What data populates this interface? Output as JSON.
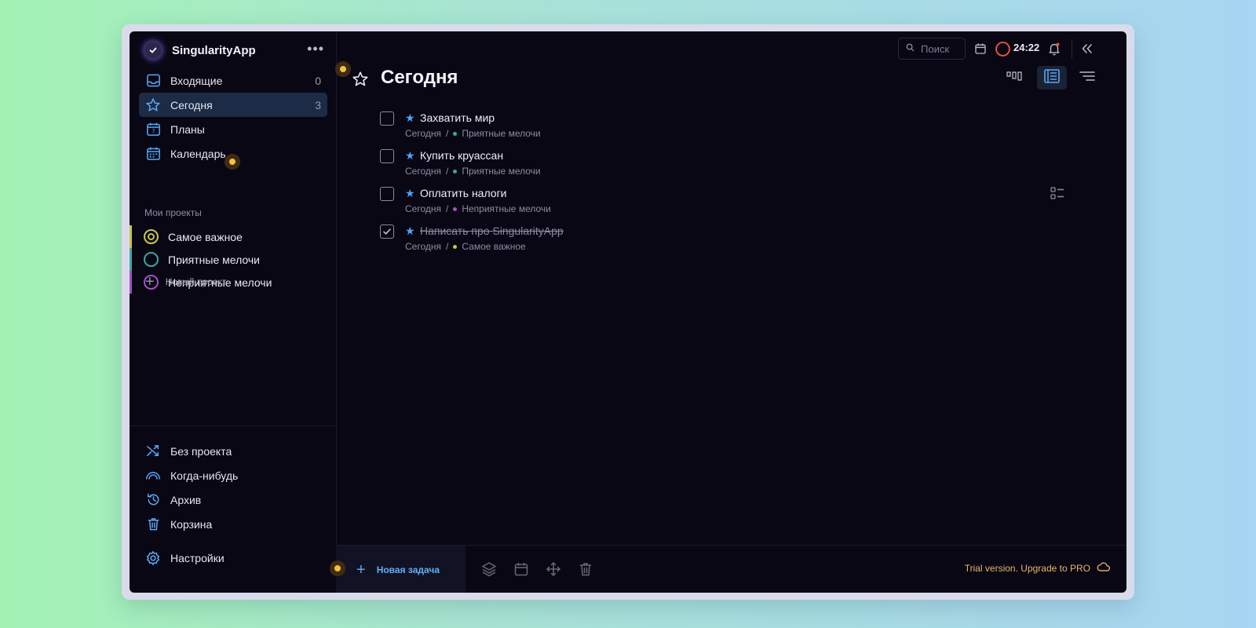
{
  "app": {
    "name": "SingularityApp"
  },
  "sidebar": {
    "nav": [
      {
        "label": "Входящие",
        "count": "0",
        "icon": "inbox-icon"
      },
      {
        "label": "Сегодня",
        "count": "3",
        "icon": "star-icon",
        "active": true
      },
      {
        "label": "Планы",
        "count": "",
        "icon": "plans-calendar-icon"
      },
      {
        "label": "Календарь",
        "count": "",
        "icon": "calendar-icon"
      }
    ],
    "projects_title": "Мои проекты",
    "projects": [
      {
        "label": "Самое важное",
        "color": "#c9c34a"
      },
      {
        "label": "Приятные мелочи",
        "color": "#3aa8a0"
      },
      {
        "label": "Неприятные мелочи",
        "color": "#a44fc4"
      }
    ],
    "new_project": "Новый проект",
    "bottom_nav": [
      {
        "label": "Без проекта",
        "icon": "shuffle-icon"
      },
      {
        "label": "Когда-нибудь",
        "icon": "rainbow-icon"
      },
      {
        "label": "Архив",
        "icon": "history-icon"
      },
      {
        "label": "Корзина",
        "icon": "trash-icon"
      }
    ],
    "settings": "Настройки"
  },
  "toolbar": {
    "search_placeholder": "Поиск",
    "timer": "24:22"
  },
  "main": {
    "title": "Сегодня",
    "tasks": [
      {
        "title": "Захватить мир",
        "date": "Сегодня",
        "project": "Приятные мелочи",
        "project_color": "#3aa8a0",
        "done": false
      },
      {
        "title": "Купить круассан",
        "date": "Сегодня",
        "project": "Приятные мелочи",
        "project_color": "#3aa8a0",
        "done": false
      },
      {
        "title": "Оплатить налоги",
        "date": "Сегодня",
        "project": "Неприятные мелочи",
        "project_color": "#a44fc4",
        "done": false
      },
      {
        "title": "Написать про SingularityApp",
        "date": "Сегодня",
        "project": "Самое важное",
        "project_color": "#c9c34a",
        "done": true
      }
    ]
  },
  "bottom_bar": {
    "new_task": "Новая задача",
    "trial": "Trial version. Upgrade to PRO"
  },
  "colors": {
    "accent": "#4fa3f7",
    "background": "#0a0715",
    "trial": "#e5b869",
    "notification_dot": "#e8553f",
    "timer_ring": "#e8553f"
  }
}
